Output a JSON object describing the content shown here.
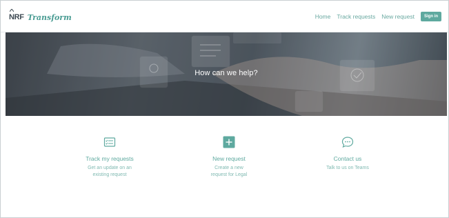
{
  "header": {
    "logo_mark": "NRF",
    "logo_name": "Transform",
    "nav": {
      "home": "Home",
      "track": "Track requests",
      "new": "New request",
      "signin": "Sign in"
    }
  },
  "hero": {
    "title": "How can we help?"
  },
  "cards": [
    {
      "icon": "checklist-icon",
      "title": "Track my requests",
      "desc_line1": "Get an update on an",
      "desc_line2": "existing request"
    },
    {
      "icon": "plus-icon",
      "title": "New request",
      "desc_line1": "Create a new",
      "desc_line2": "request for Legal"
    },
    {
      "icon": "chat-bubble-icon",
      "title": "Contact us",
      "desc_line1": "Talk to us on Teams",
      "desc_line2": ""
    }
  ],
  "colors": {
    "accent": "#5ea99f",
    "nav_text": "#6aa9a1",
    "hero_dark": "#3a4047"
  }
}
